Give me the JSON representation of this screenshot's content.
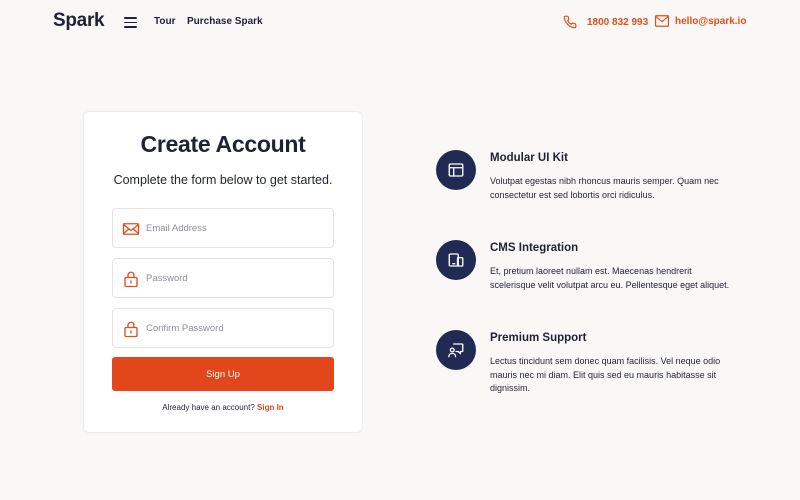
{
  "header": {
    "logo": "Spark",
    "nav": [
      {
        "label": "Tour"
      },
      {
        "label": "Purchase Spark"
      }
    ],
    "phone": "1800 832 993",
    "email": "hello@spark.io"
  },
  "form": {
    "title": "Create Account",
    "subtitle": "Complete the form below to get started.",
    "email_placeholder": "Email Address",
    "email_value": "",
    "password_placeholder": "Password",
    "password_value": "",
    "confirm_placeholder": "Confirm Password",
    "confirm_value": "",
    "submit_label": "Sign Up",
    "signin_prompt": "Already have an account?",
    "signin_link": "Sign In"
  },
  "features": [
    {
      "icon": "browser-window-icon",
      "title": "Modular UI Kit",
      "description": "Volutpat egestas nibh rhoncus mauris semper. Quam nec consectetur est sed lobortis orci ridiculus."
    },
    {
      "icon": "devices-icon",
      "title": "CMS Integration",
      "description": "Et, pretium laoreet nullam est. Maecenas hendrerit scelerisque velit volutpat arcu eu. Pellentesque eget aliquet."
    },
    {
      "icon": "support-chat-icon",
      "title": "Premium Support",
      "description": "Lectus tincidunt sem donec quam facilisis. Vel neque odio mauris nec mi diam. Elit quis sed eu mauris habitasse sit dignissim."
    }
  ],
  "colors": {
    "accent": "#e2461b",
    "navy": "#202a53",
    "background": "#faf8f6",
    "text": "#1f2233"
  }
}
